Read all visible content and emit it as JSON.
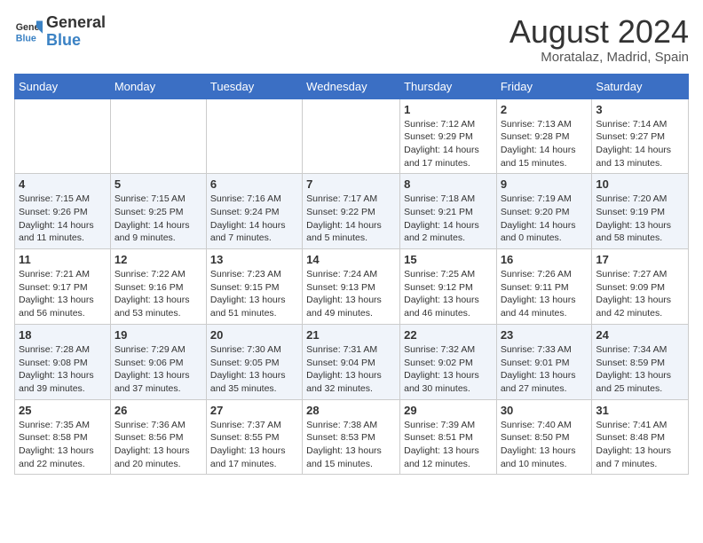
{
  "header": {
    "logo_general": "General",
    "logo_blue": "Blue",
    "month_year": "August 2024",
    "location": "Moratalaz, Madrid, Spain"
  },
  "weekdays": [
    "Sunday",
    "Monday",
    "Tuesday",
    "Wednesday",
    "Thursday",
    "Friday",
    "Saturday"
  ],
  "weeks": [
    [
      {
        "day": "",
        "info": ""
      },
      {
        "day": "",
        "info": ""
      },
      {
        "day": "",
        "info": ""
      },
      {
        "day": "",
        "info": ""
      },
      {
        "day": "1",
        "info": "Sunrise: 7:12 AM\nSunset: 9:29 PM\nDaylight: 14 hours\nand 17 minutes."
      },
      {
        "day": "2",
        "info": "Sunrise: 7:13 AM\nSunset: 9:28 PM\nDaylight: 14 hours\nand 15 minutes."
      },
      {
        "day": "3",
        "info": "Sunrise: 7:14 AM\nSunset: 9:27 PM\nDaylight: 14 hours\nand 13 minutes."
      }
    ],
    [
      {
        "day": "4",
        "info": "Sunrise: 7:15 AM\nSunset: 9:26 PM\nDaylight: 14 hours\nand 11 minutes."
      },
      {
        "day": "5",
        "info": "Sunrise: 7:15 AM\nSunset: 9:25 PM\nDaylight: 14 hours\nand 9 minutes."
      },
      {
        "day": "6",
        "info": "Sunrise: 7:16 AM\nSunset: 9:24 PM\nDaylight: 14 hours\nand 7 minutes."
      },
      {
        "day": "7",
        "info": "Sunrise: 7:17 AM\nSunset: 9:22 PM\nDaylight: 14 hours\nand 5 minutes."
      },
      {
        "day": "8",
        "info": "Sunrise: 7:18 AM\nSunset: 9:21 PM\nDaylight: 14 hours\nand 2 minutes."
      },
      {
        "day": "9",
        "info": "Sunrise: 7:19 AM\nSunset: 9:20 PM\nDaylight: 14 hours\nand 0 minutes."
      },
      {
        "day": "10",
        "info": "Sunrise: 7:20 AM\nSunset: 9:19 PM\nDaylight: 13 hours\nand 58 minutes."
      }
    ],
    [
      {
        "day": "11",
        "info": "Sunrise: 7:21 AM\nSunset: 9:17 PM\nDaylight: 13 hours\nand 56 minutes."
      },
      {
        "day": "12",
        "info": "Sunrise: 7:22 AM\nSunset: 9:16 PM\nDaylight: 13 hours\nand 53 minutes."
      },
      {
        "day": "13",
        "info": "Sunrise: 7:23 AM\nSunset: 9:15 PM\nDaylight: 13 hours\nand 51 minutes."
      },
      {
        "day": "14",
        "info": "Sunrise: 7:24 AM\nSunset: 9:13 PM\nDaylight: 13 hours\nand 49 minutes."
      },
      {
        "day": "15",
        "info": "Sunrise: 7:25 AM\nSunset: 9:12 PM\nDaylight: 13 hours\nand 46 minutes."
      },
      {
        "day": "16",
        "info": "Sunrise: 7:26 AM\nSunset: 9:11 PM\nDaylight: 13 hours\nand 44 minutes."
      },
      {
        "day": "17",
        "info": "Sunrise: 7:27 AM\nSunset: 9:09 PM\nDaylight: 13 hours\nand 42 minutes."
      }
    ],
    [
      {
        "day": "18",
        "info": "Sunrise: 7:28 AM\nSunset: 9:08 PM\nDaylight: 13 hours\nand 39 minutes."
      },
      {
        "day": "19",
        "info": "Sunrise: 7:29 AM\nSunset: 9:06 PM\nDaylight: 13 hours\nand 37 minutes."
      },
      {
        "day": "20",
        "info": "Sunrise: 7:30 AM\nSunset: 9:05 PM\nDaylight: 13 hours\nand 35 minutes."
      },
      {
        "day": "21",
        "info": "Sunrise: 7:31 AM\nSunset: 9:04 PM\nDaylight: 13 hours\nand 32 minutes."
      },
      {
        "day": "22",
        "info": "Sunrise: 7:32 AM\nSunset: 9:02 PM\nDaylight: 13 hours\nand 30 minutes."
      },
      {
        "day": "23",
        "info": "Sunrise: 7:33 AM\nSunset: 9:01 PM\nDaylight: 13 hours\nand 27 minutes."
      },
      {
        "day": "24",
        "info": "Sunrise: 7:34 AM\nSunset: 8:59 PM\nDaylight: 13 hours\nand 25 minutes."
      }
    ],
    [
      {
        "day": "25",
        "info": "Sunrise: 7:35 AM\nSunset: 8:58 PM\nDaylight: 13 hours\nand 22 minutes."
      },
      {
        "day": "26",
        "info": "Sunrise: 7:36 AM\nSunset: 8:56 PM\nDaylight: 13 hours\nand 20 minutes."
      },
      {
        "day": "27",
        "info": "Sunrise: 7:37 AM\nSunset: 8:55 PM\nDaylight: 13 hours\nand 17 minutes."
      },
      {
        "day": "28",
        "info": "Sunrise: 7:38 AM\nSunset: 8:53 PM\nDaylight: 13 hours\nand 15 minutes."
      },
      {
        "day": "29",
        "info": "Sunrise: 7:39 AM\nSunset: 8:51 PM\nDaylight: 13 hours\nand 12 minutes."
      },
      {
        "day": "30",
        "info": "Sunrise: 7:40 AM\nSunset: 8:50 PM\nDaylight: 13 hours\nand 10 minutes."
      },
      {
        "day": "31",
        "info": "Sunrise: 7:41 AM\nSunset: 8:48 PM\nDaylight: 13 hours\nand 7 minutes."
      }
    ]
  ]
}
